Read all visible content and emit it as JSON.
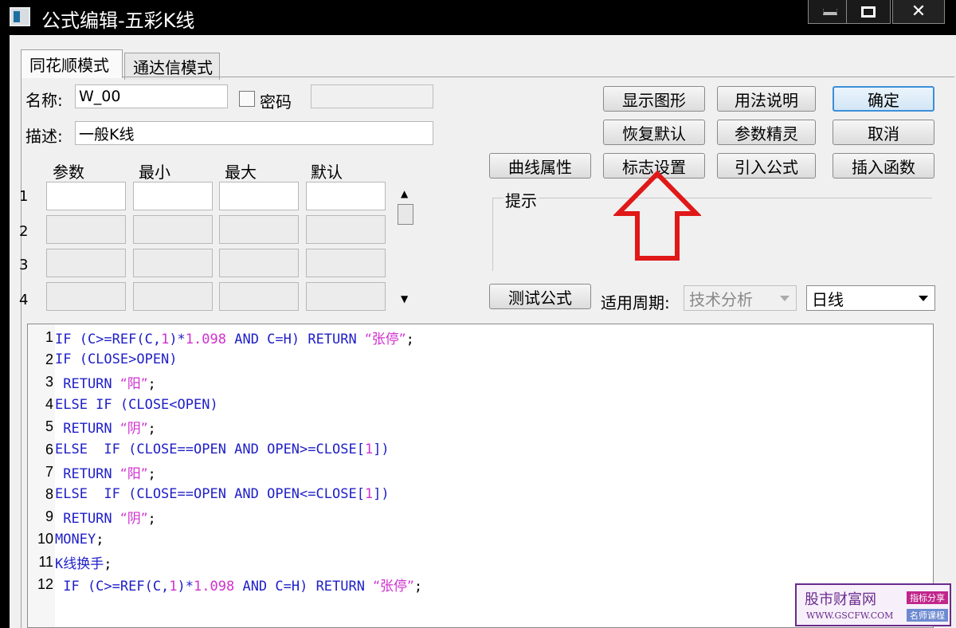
{
  "window": {
    "title": "公式编辑-五彩K线"
  },
  "tabs": [
    {
      "label": "同花顺模式",
      "active": true
    },
    {
      "label": "通达信模式",
      "active": false
    }
  ],
  "form": {
    "name_label": "名称:",
    "name_value": "W_00",
    "password_label": "密码",
    "password_checked": false,
    "desc_label": "描述:",
    "desc_value": "一般K线"
  },
  "params": {
    "headers": [
      "参数",
      "最小",
      "最大",
      "默认"
    ],
    "rows": [
      "1",
      "2",
      "3",
      "4"
    ]
  },
  "buttons": {
    "show_graph": "显示图形",
    "usage": "用法说明",
    "ok": "确定",
    "restore": "恢复默认",
    "param_wizard": "参数精灵",
    "cancel": "取消",
    "curve_props": "曲线属性",
    "flag_settings": "标志设置",
    "import_formula": "引入公式",
    "insert_func": "插入函数",
    "test_formula": "测试公式"
  },
  "hint": {
    "label": "提示"
  },
  "period": {
    "label": "适用周期:",
    "category_value": "技术分析",
    "period_value": "日线"
  },
  "code_lines": [
    {
      "n": "1",
      "segs": [
        [
          "k",
          "IF (C>=REF(C,"
        ],
        [
          "n",
          "1"
        ],
        [
          "k",
          ")*"
        ],
        [
          "n",
          "1.098"
        ],
        [
          "k",
          " AND C=H) RETURN "
        ],
        [
          "s",
          "“张停”"
        ],
        [
          "p",
          ";"
        ]
      ]
    },
    {
      "n": "2",
      "segs": [
        [
          "k",
          "IF (CLOSE>OPEN)"
        ]
      ]
    },
    {
      "n": "3",
      "segs": [
        [
          "k",
          " RETURN "
        ],
        [
          "s",
          "“阳”"
        ],
        [
          "p",
          ";"
        ]
      ]
    },
    {
      "n": "4",
      "segs": [
        [
          "k",
          "ELSE IF (CLOSE<OPEN)"
        ]
      ]
    },
    {
      "n": "5",
      "segs": [
        [
          "k",
          " RETURN "
        ],
        [
          "s",
          "“阴”"
        ],
        [
          "p",
          ";"
        ]
      ]
    },
    {
      "n": "6",
      "segs": [
        [
          "k",
          "ELSE  IF (CLOSE==OPEN AND OPEN>=CLOSE["
        ],
        [
          "n",
          "1"
        ],
        [
          "k",
          "])"
        ]
      ]
    },
    {
      "n": "7",
      "segs": [
        [
          "k",
          " RETURN "
        ],
        [
          "s",
          "“阳”"
        ],
        [
          "p",
          ";"
        ]
      ]
    },
    {
      "n": "8",
      "segs": [
        [
          "k",
          "ELSE  IF (CLOSE==OPEN AND OPEN<=CLOSE["
        ],
        [
          "n",
          "1"
        ],
        [
          "k",
          "])"
        ]
      ]
    },
    {
      "n": "9",
      "segs": [
        [
          "k",
          " RETURN "
        ],
        [
          "s",
          "“阴”"
        ],
        [
          "p",
          ";"
        ]
      ]
    },
    {
      "n": "10",
      "segs": [
        [
          "k",
          "MONEY"
        ],
        [
          "p",
          ";"
        ]
      ]
    },
    {
      "n": "11",
      "segs": [
        [
          "k",
          "K线换手"
        ],
        [
          "p",
          ";"
        ]
      ]
    },
    {
      "n": "12",
      "segs": [
        [
          "k",
          " IF (C>=REF(C,"
        ],
        [
          "n",
          "1"
        ],
        [
          "k",
          ")*"
        ],
        [
          "n",
          "1.098"
        ],
        [
          "k",
          " AND C=H) RETURN "
        ],
        [
          "s",
          "“张停”"
        ],
        [
          "p",
          ";"
        ]
      ]
    }
  ],
  "watermark": {
    "main": "股市财富网",
    "url": "WWW.GSCFW.COM",
    "tag1": "指标分享",
    "tag2": "名师课程"
  },
  "colors": {
    "keyword": "#2020c8",
    "string": "#d030d0",
    "arrow": "#e01818",
    "watermark": "#6a2a8c"
  }
}
